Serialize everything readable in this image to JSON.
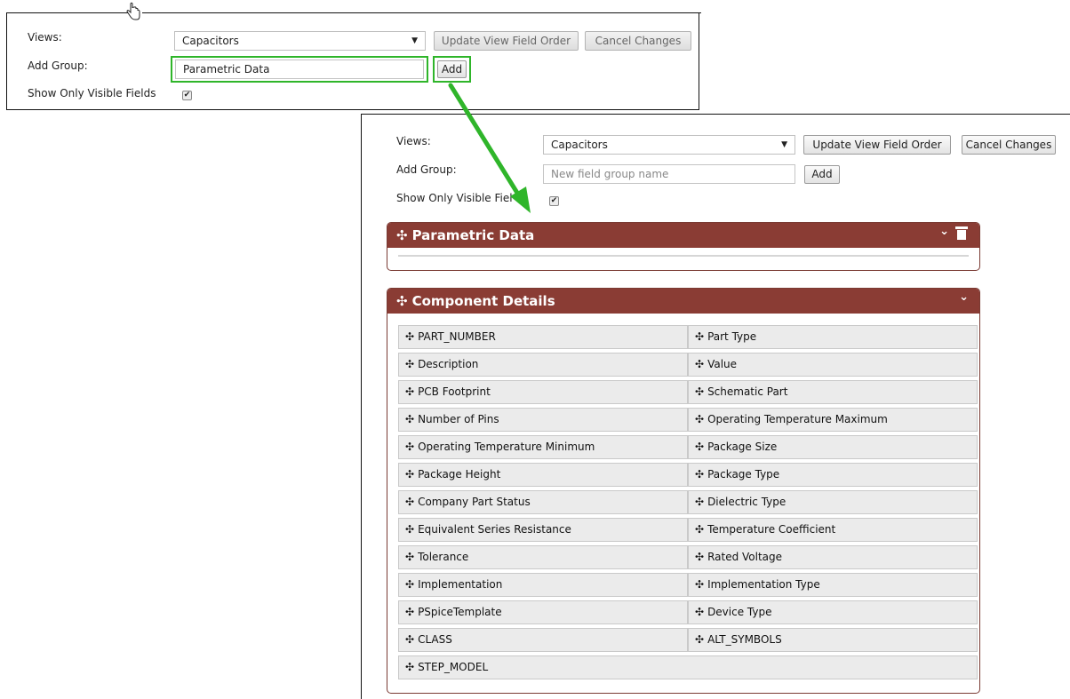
{
  "top_form": {
    "views_label": "Views:",
    "views_value": "Capacitors",
    "update_button": "Update View Field Order",
    "cancel_button": "Cancel Changes",
    "add_group_label": "Add Group:",
    "add_group_value": "Parametric Data",
    "add_button": "Add",
    "show_visible_label": "Show Only Visible Fields"
  },
  "bottom_form": {
    "views_label": "Views:",
    "views_value": "Capacitors",
    "update_button": "Update View Field Order",
    "cancel_button": "Cancel Changes",
    "add_group_label": "Add Group:",
    "add_group_placeholder": "New field group name",
    "add_button": "Add",
    "show_visible_label": "Show Only Visible Fiel"
  },
  "groups": [
    {
      "title": "Parametric Data"
    },
    {
      "title": "Component Details"
    }
  ],
  "fields": [
    [
      "PART_NUMBER",
      "Part Type"
    ],
    [
      "Description",
      "Value"
    ],
    [
      "PCB Footprint",
      "Schematic Part"
    ],
    [
      "Number of Pins",
      "Operating Temperature Maximum"
    ],
    [
      "Operating Temperature Minimum",
      "Package Size"
    ],
    [
      "Package Height",
      "Package Type"
    ],
    [
      "Company Part Status",
      "Dielectric Type"
    ],
    [
      "Equivalent Series Resistance",
      "Temperature Coefficient"
    ],
    [
      "Tolerance",
      "Rated Voltage"
    ],
    [
      "Implementation",
      "Implementation Type"
    ],
    [
      "PSpiceTemplate",
      "Device Type"
    ],
    [
      "CLASS",
      "ALT_SYMBOLS"
    ],
    [
      "STEP_MODEL"
    ]
  ],
  "icons": {
    "move": "✣",
    "chevron": "⌄",
    "caret": "▼",
    "check": "✔"
  },
  "colors": {
    "group_header": "#8a3c34",
    "highlight": "#2fb52a"
  }
}
